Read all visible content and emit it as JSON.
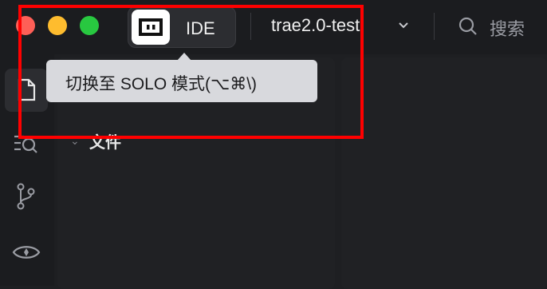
{
  "titlebar": {
    "mode_label": "IDE",
    "project_name": "trae2.0-test",
    "search_label": "搜索"
  },
  "tooltip": {
    "text": "切换至 SOLO 模式(⌥⌘\\)"
  },
  "explorer": {
    "section_title": "文件"
  },
  "activity_bar": {
    "items": [
      "files-icon",
      "search-list-icon",
      "source-control-icon",
      "preview-eye-icon"
    ],
    "active": "files-icon"
  },
  "colors": {
    "highlight": "#ff0000",
    "close": "#fe5f57",
    "minimize": "#febc2e",
    "zoom": "#28c840",
    "tooltip_bg": "#d8d9dd"
  }
}
